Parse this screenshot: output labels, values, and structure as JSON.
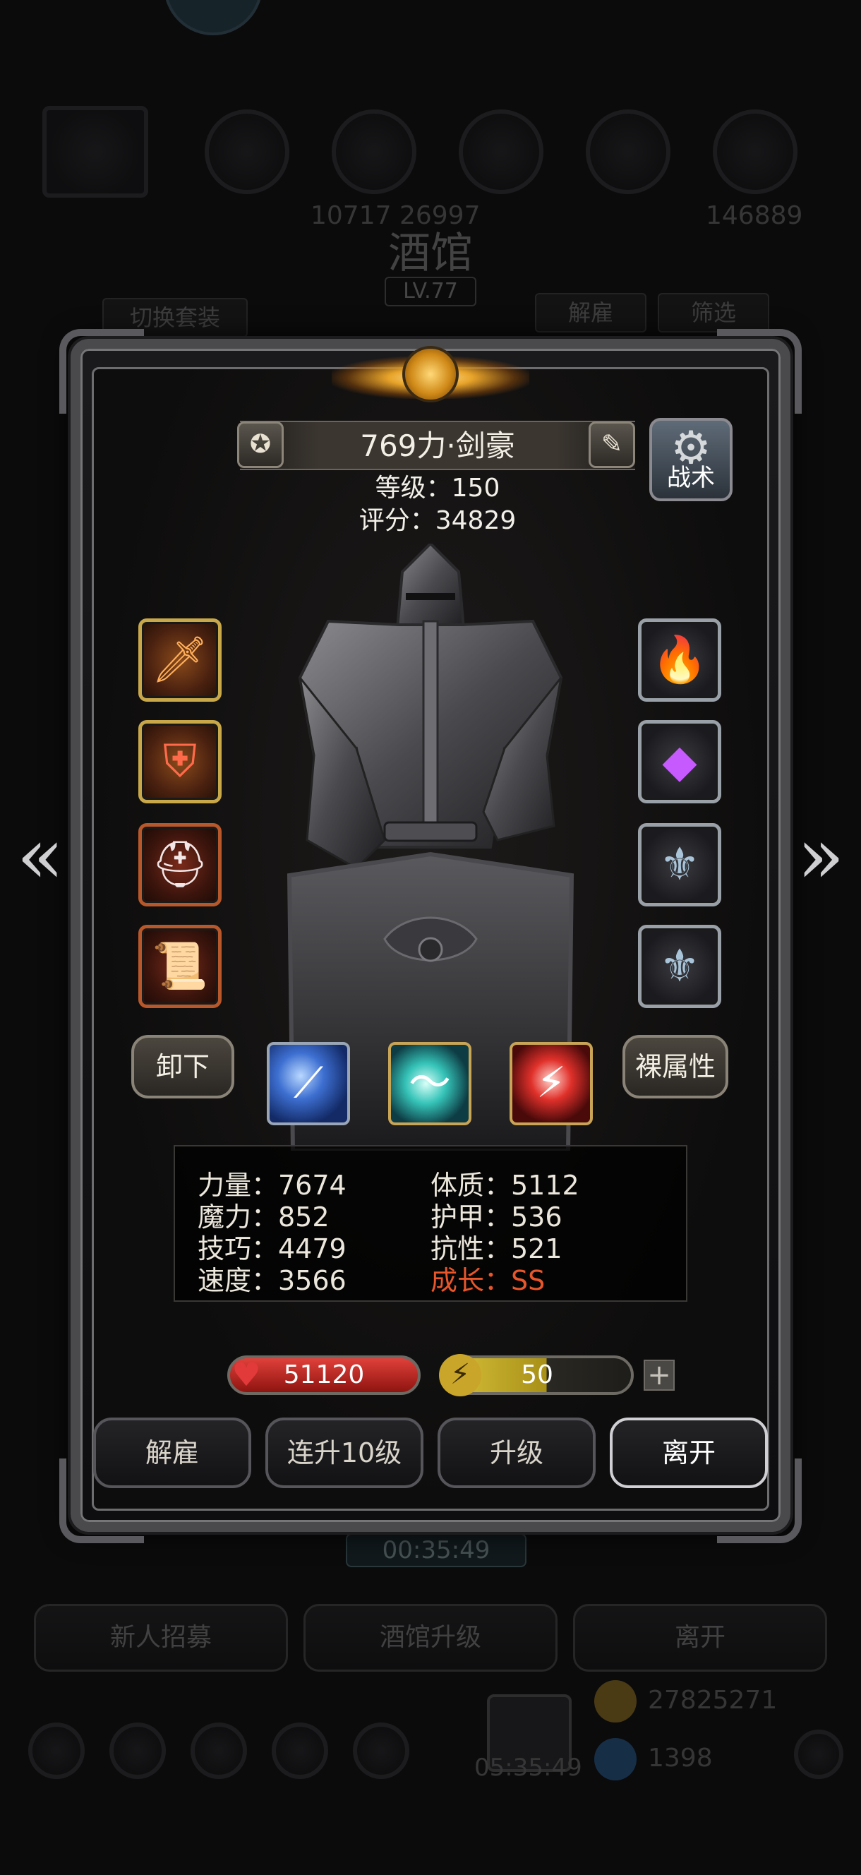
{
  "background": {
    "title": "酒馆",
    "level": "LV.77",
    "switch_outfit_label": "切换套装",
    "dismiss_label": "解雇",
    "filter_label": "筛选",
    "resource_text_left": "10717 26997",
    "resource_text_right": "146889",
    "timer": "00:35:49",
    "bottom_buttons": {
      "recruit": "新人招募",
      "upgrade_tavern": "酒馆升级",
      "leave": "离开"
    },
    "gold": "27825271",
    "gems": "1398",
    "gift_timer": "05:35:49"
  },
  "hero": {
    "name": "769力·剑豪",
    "level_line": "等级：150",
    "score_line": "评分：34829",
    "tactics_label": "战术"
  },
  "buttons": {
    "unequip": "卸下",
    "base_attributes": "裸属性",
    "dismiss": "解雇",
    "level_up_10": "连升10级",
    "level_up": "升级",
    "leave": "离开",
    "plus": "+"
  },
  "stats": {
    "strength": "力量：7674",
    "magic": "魔力：852",
    "skill": "技巧：4479",
    "speed": "速度：3566",
    "constitution": "体质：5112",
    "armor": "护甲：536",
    "resistance": "抗性：521",
    "growth_label": "成长：",
    "growth_value": "SS"
  },
  "bars": {
    "hp_value": 51120,
    "hp_text": "51120",
    "energy_value": 50,
    "energy_text": "50",
    "energy_fill": 0.55
  },
  "icons": {
    "left_slots": [
      "sword-icon",
      "chest-armor-icon",
      "helmet-icon",
      "scroll-icon"
    ],
    "right_slots": [
      "flame-ring-icon",
      "purple-gem-icon",
      "crest-emblem-icon",
      "crest-emblem-icon"
    ],
    "skills": [
      "blue-slash-icon",
      "cyan-wind-icon",
      "red-strike-icon"
    ]
  },
  "colors": {
    "growth": "#e8562a",
    "hp": "#e0403a",
    "energy": "#d8c23a",
    "gold_trim": "#c9a84a"
  }
}
